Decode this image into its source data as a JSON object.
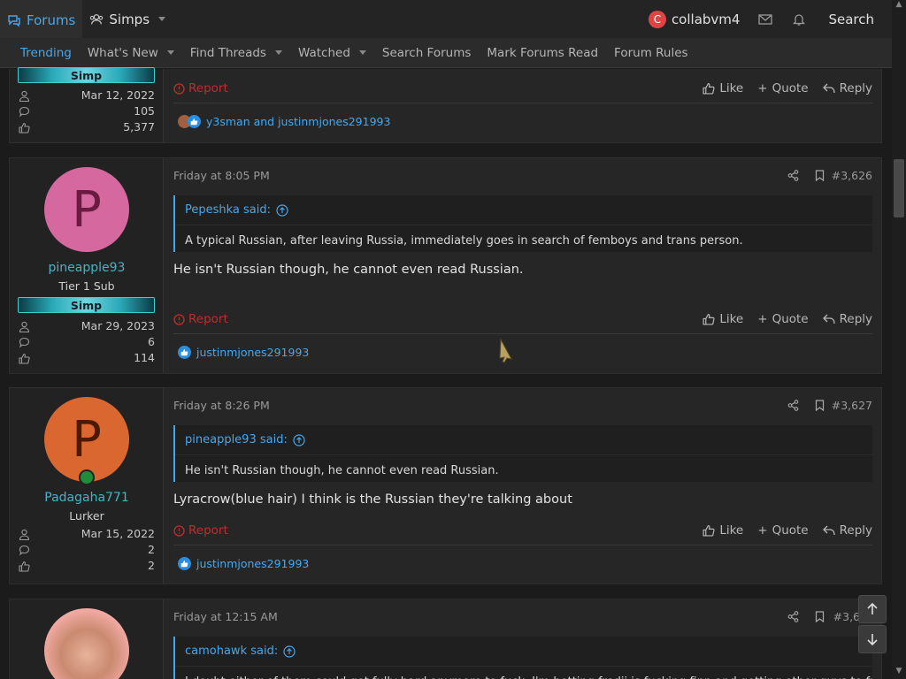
{
  "topbar": {
    "forums_label": "Forums",
    "simps_label": "Simps",
    "username": "collabvm4",
    "avatar_letter": "C",
    "search_label": "Search"
  },
  "subnav": {
    "items": [
      {
        "label": "Trending"
      },
      {
        "label": "What's New"
      },
      {
        "label": "Find Threads"
      },
      {
        "label": "Watched"
      },
      {
        "label": "Search Forums"
      },
      {
        "label": "Mark Forums Read"
      },
      {
        "label": "Forum Rules"
      }
    ]
  },
  "posts": [
    {
      "banner": "Simp",
      "joined": "Mar 12, 2022",
      "messages": "105",
      "reactions": "5,377",
      "report": "Report",
      "like": "Like",
      "quote": "Quote",
      "reply": "Reply",
      "reacted_by": "y3sman and justinmjones291993"
    },
    {
      "avatar_letter": "P",
      "username": "pineapple93",
      "title": "Tier 1 Sub",
      "banner": "Simp",
      "joined": "Mar 29, 2023",
      "messages": "6",
      "reactions": "114",
      "date": "Friday at 8:05 PM",
      "number": "#3,626",
      "quote_author": "Pepeshka said:",
      "quote_text": "A typical Russian, after leaving Russia, immediately goes in search of femboys and trans person.",
      "text": "He isn't Russian though, he cannot even read Russian.",
      "report": "Report",
      "like": "Like",
      "quote": "Quote",
      "reply": "Reply",
      "reacted_by": "justinmjones291993"
    },
    {
      "avatar_letter": "P",
      "username": "Padagaha771",
      "title": "Lurker",
      "joined": "Mar 15, 2022",
      "messages": "2",
      "reactions": "2",
      "date": "Friday at 8:26 PM",
      "number": "#3,627",
      "quote_author": "pineapple93 said:",
      "quote_text": "He isn't Russian though, he cannot even read Russian.",
      "text": "Lyracrow(blue hair) I think is the Russian they're talking about",
      "report": "Report",
      "like": "Like",
      "quote": "Quote",
      "reply": "Reply",
      "reacted_by": "justinmjones291993"
    },
    {
      "date": "Friday at 12:15 AM",
      "number": "#3,6",
      "quote_author": "camohawk said:",
      "quote_text": "I doubt either of them could get fully hard anymore to fuck. I'm betting fredii is fucking finn and getting other guys to fuck"
    }
  ],
  "colors": {
    "accent": "#47a7eb",
    "username": "#47b3c5",
    "report": "#c12d2d",
    "avatar_pink": "#d4689f",
    "avatar_orange": "#d9672f"
  }
}
